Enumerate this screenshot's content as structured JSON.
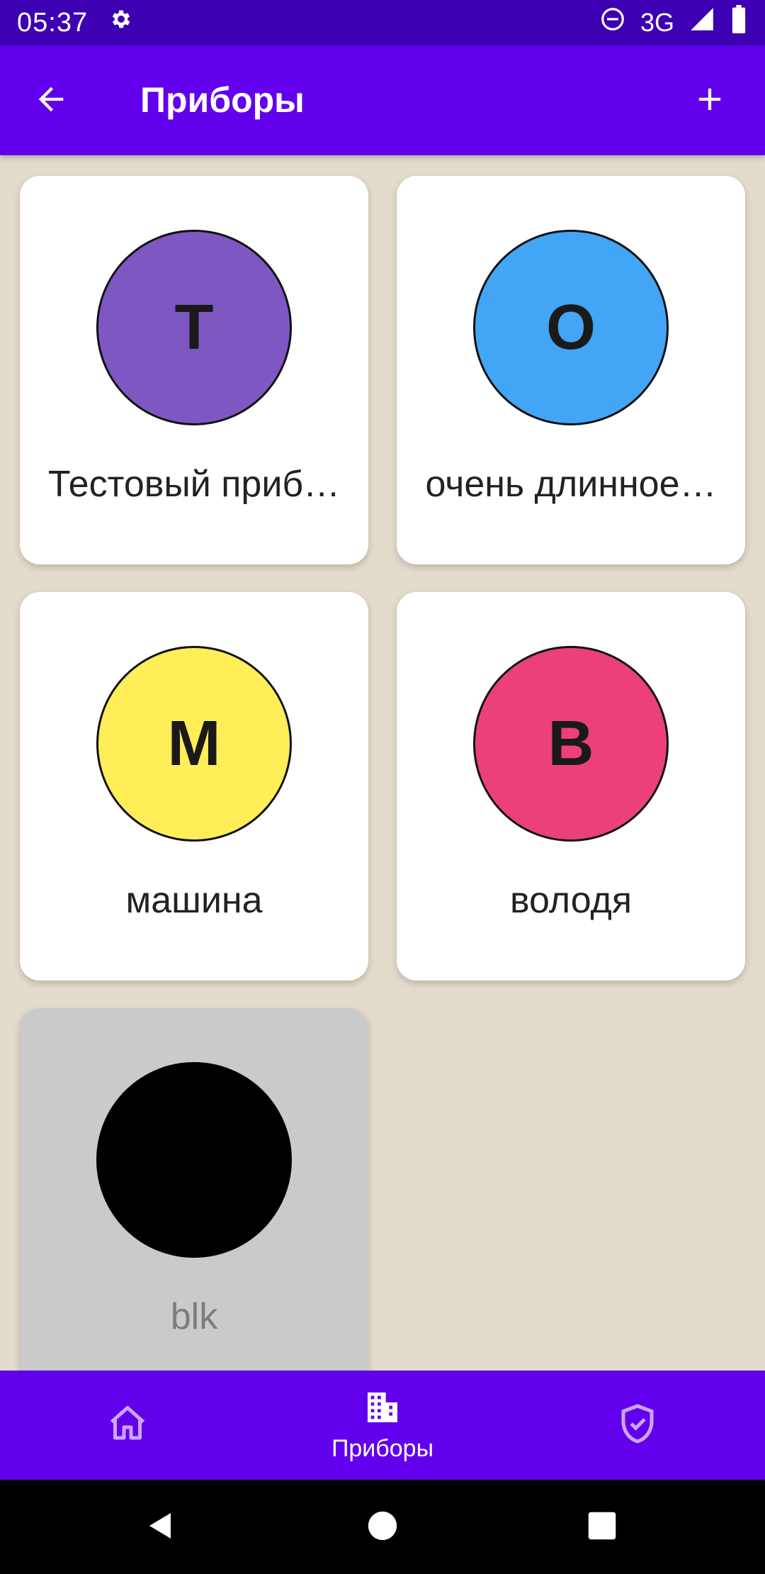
{
  "status_bar": {
    "time": "05:37",
    "network": "3G",
    "icons": [
      "settings-gear",
      "do-not-disturb",
      "signal",
      "battery"
    ]
  },
  "app_bar": {
    "title": "Приборы",
    "back_icon": "arrow-left",
    "add_icon": "plus"
  },
  "devices": [
    {
      "initial": "Т",
      "label": "Тестовый приб…",
      "color": "#7e57c2",
      "enabled": true
    },
    {
      "initial": "О",
      "label": "очень длинное…",
      "color": "#42a5f5",
      "enabled": true
    },
    {
      "initial": "М",
      "label": "машина",
      "color": "#ffee58",
      "enabled": true
    },
    {
      "initial": "В",
      "label": "володя",
      "color": "#ec407a",
      "enabled": true
    },
    {
      "initial": "",
      "label": "blk",
      "color": "#000000",
      "enabled": false
    }
  ],
  "bottom_nav": {
    "items": [
      {
        "icon": "home",
        "label": "",
        "active": false
      },
      {
        "icon": "building",
        "label": "Приборы",
        "active": true
      },
      {
        "icon": "shield-check",
        "label": "",
        "active": false
      }
    ]
  },
  "colors": {
    "status_bar": "#3d00b2",
    "app_bar": "#6200ee",
    "background": "#e3dbcb",
    "card": "#ffffff",
    "card_disabled": "#cacaca",
    "nav_inactive_icon": "#c9a7ff"
  }
}
